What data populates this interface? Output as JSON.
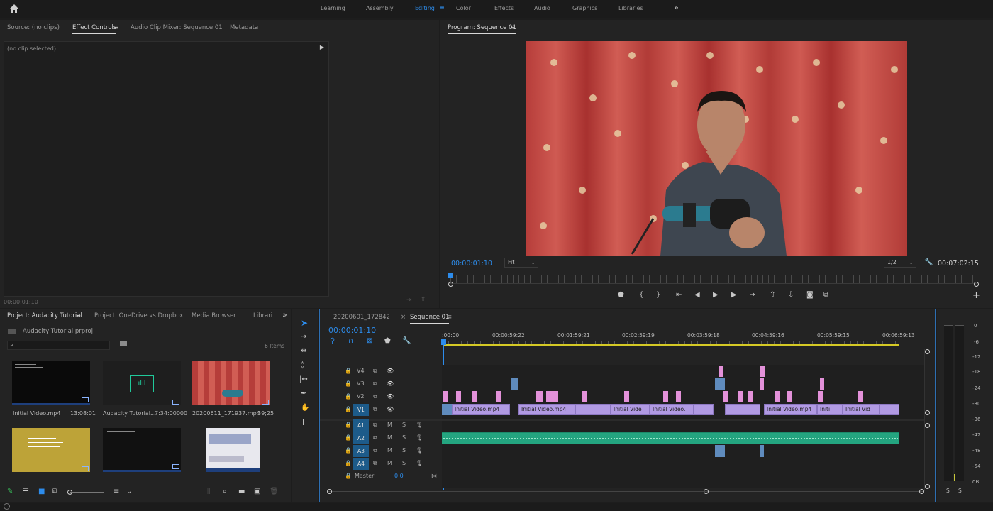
{
  "topbar": {
    "workspaces": [
      "Learning",
      "Assembly",
      "Editing",
      "Color",
      "Effects",
      "Audio",
      "Graphics",
      "Libraries"
    ],
    "active": "Editing",
    "more": "»",
    "home_icon": "home-icon"
  },
  "source_panel": {
    "tabs": [
      "Source: (no clips)",
      "Effect Controls",
      "Audio Clip Mixer: Sequence 01",
      "Metadata"
    ],
    "active": "Effect Controls",
    "no_clip": "(no clip selected)",
    "timecode": "00:00:01:10"
  },
  "program": {
    "title": "Program: Sequence 01",
    "timecode": "00:00:01:10",
    "fit": "Fit",
    "resolution": "1/2",
    "duration": "00:07:02:15"
  },
  "project": {
    "tabs": [
      "Project: Audacity Tutorial",
      "Project: OneDrive vs Dropbox",
      "Media Browser",
      "Librari"
    ],
    "file": "Audacity Tutorial.prproj",
    "items": "6 Items",
    "search_placeholder": "",
    "thumbs": [
      {
        "name": "Initial Video.mp4",
        "dur": "13:08:01"
      },
      {
        "name": "Audacity Tutorial...",
        "dur": "7:34:00000"
      },
      {
        "name": "20200611_171937.mp4",
        "dur": "39;25"
      },
      {
        "name": "",
        "dur": ""
      },
      {
        "name": "",
        "dur": ""
      },
      {
        "name": "",
        "dur": ""
      }
    ]
  },
  "timeline": {
    "tabs": [
      "20200601_172842",
      "Sequence 01"
    ],
    "active": "Sequence 01",
    "timecode": "00:00:01:10",
    "ruler": [
      ":00:00",
      "00:00:59:22",
      "00:01:59:21",
      "00:02:59:19",
      "00:03:59:18",
      "00:04:59:16",
      "00:05:59:15",
      "00:06:59:13"
    ],
    "video_tracks": [
      "V4",
      "V3",
      "V2",
      "V1"
    ],
    "audio_tracks": [
      "A1",
      "A2",
      "A3",
      "A4"
    ],
    "master_label": "Master",
    "master_value": "0.0",
    "clip_label": "Initial Video.mp4",
    "clip_short": "Initial Vide",
    "clip_short2": "Initial Video.",
    "clip_short3": "Initi",
    "clip_short4": "Initial Vid"
  },
  "meter": {
    "scale": [
      "0",
      "-6",
      "-12",
      "-18",
      "-24",
      "-30",
      "-36",
      "-42",
      "-48",
      "-54",
      "dB"
    ],
    "solo": [
      "S",
      "S"
    ]
  },
  "colors": {
    "accent": "#2d8ceb",
    "video_clip": "#b19ae3",
    "audio_clip": "#24a580",
    "pink": "#e391d9"
  }
}
